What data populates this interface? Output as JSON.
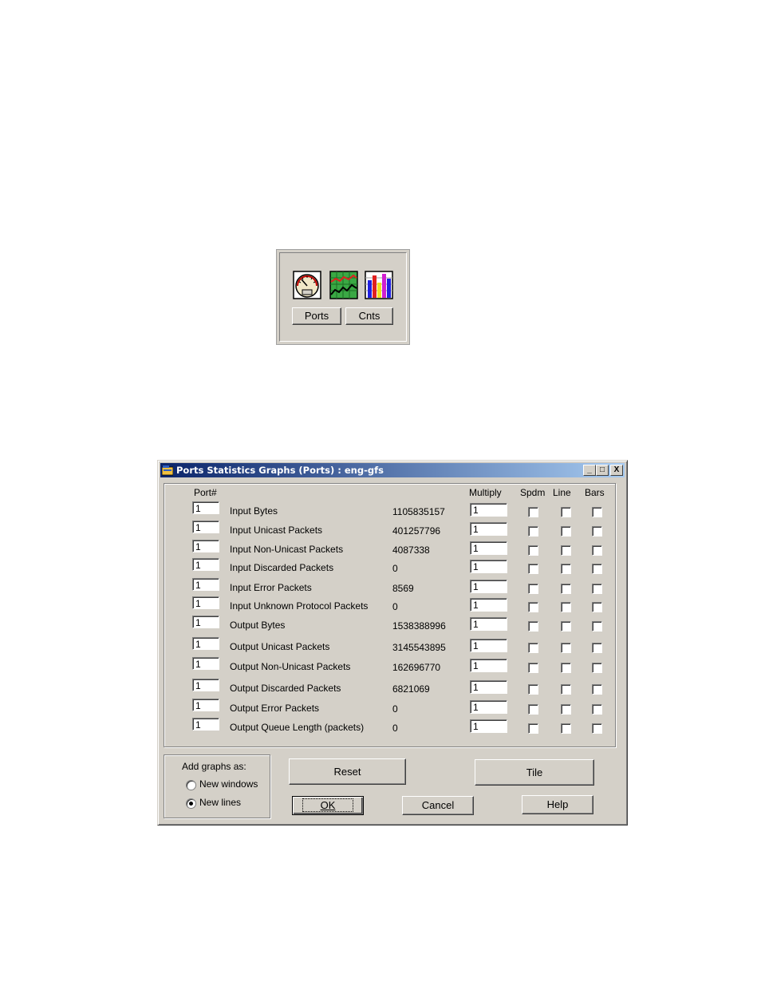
{
  "toolbar": {
    "icons": [
      "gauge-icon",
      "line-graph-icon",
      "bar-graph-icon"
    ],
    "ports_button": "Ports",
    "cnts_button": "Cnts"
  },
  "dialog": {
    "title": "Ports Statistics Graphs (Ports) : eng-gfs",
    "title_buttons": {
      "minimize": "_",
      "maximize": "□",
      "close": "X"
    },
    "headers": {
      "port": "Port#",
      "multiply": "Multiply",
      "spdm": "Spdm",
      "line": "Line",
      "bars": "Bars"
    },
    "rows": [
      {
        "port": "1",
        "label": "Input Bytes",
        "value": "1105835157",
        "multiply": "1"
      },
      {
        "port": "1",
        "label": "Input Unicast Packets",
        "value": "401257796",
        "multiply": "1"
      },
      {
        "port": "1",
        "label": "Input Non-Unicast Packets",
        "value": "4087338",
        "multiply": "1"
      },
      {
        "port": "1",
        "label": "Input Discarded Packets",
        "value": "0",
        "multiply": "1"
      },
      {
        "port": "1",
        "label": "Input Error Packets",
        "value": "8569",
        "multiply": "1"
      },
      {
        "port": "1",
        "label": "Input Unknown Protocol Packets",
        "value": "0",
        "multiply": "1"
      },
      {
        "port": "1",
        "label": "Output Bytes",
        "value": "1538388996",
        "multiply": "1"
      },
      {
        "port": "1",
        "label": "Output Unicast Packets",
        "value": "3145543895",
        "multiply": "1"
      },
      {
        "port": "1",
        "label": "Output Non-Unicast Packets",
        "value": "162696770",
        "multiply": "1"
      },
      {
        "port": "1",
        "label": "Output Discarded Packets",
        "value": "6821069",
        "multiply": "1"
      },
      {
        "port": "1",
        "label": "Output Error Packets",
        "value": "0",
        "multiply": "1"
      },
      {
        "port": "1",
        "label": "Output Queue Length (packets)",
        "value": "0",
        "multiply": "1"
      }
    ],
    "add_graphs": {
      "title": "Add graphs as:",
      "options": [
        {
          "label": "New windows",
          "selected": false
        },
        {
          "label": "New lines",
          "selected": true
        }
      ]
    },
    "buttons": {
      "reset": "Reset",
      "tile": "Tile",
      "ok": "OK",
      "cancel": "Cancel",
      "help": "Help"
    }
  }
}
